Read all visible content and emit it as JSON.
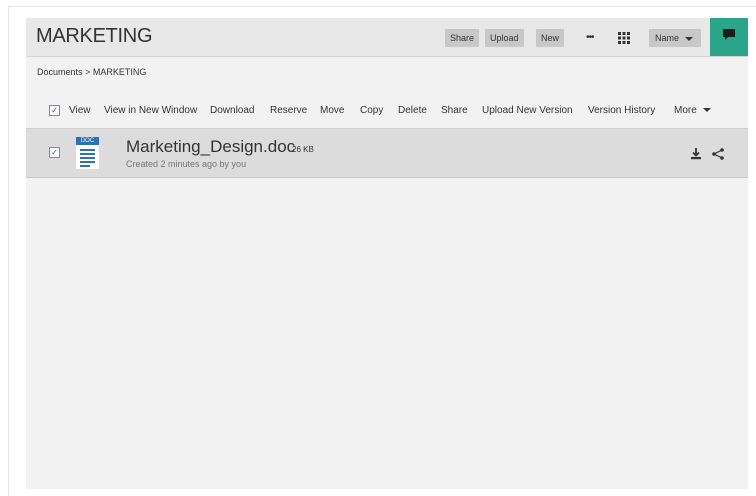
{
  "header": {
    "title": "MARKETING",
    "buttons": {
      "share": "Share",
      "upload": "Upload",
      "new": "New",
      "more_dots": "•••",
      "grid_view": "grid-icon",
      "sort": "Name"
    },
    "chat_icon": "comment-icon",
    "accent_color": "#2aa589"
  },
  "breadcrumb": {
    "root": "Documents",
    "separator": ">",
    "current": "MARKETING"
  },
  "actions": {
    "items": [
      "View",
      "View in New Window",
      "Download",
      "Reserve",
      "Move",
      "Copy",
      "Delete",
      "Share",
      "Upload New Version",
      "Version History"
    ],
    "more": "More",
    "select_all_checked": true
  },
  "files": [
    {
      "type_label": "DOC",
      "name": "Marketing_Design.doc",
      "size": "26 KB",
      "meta": "Created 2 minutes ago by you",
      "checked": true
    }
  ]
}
